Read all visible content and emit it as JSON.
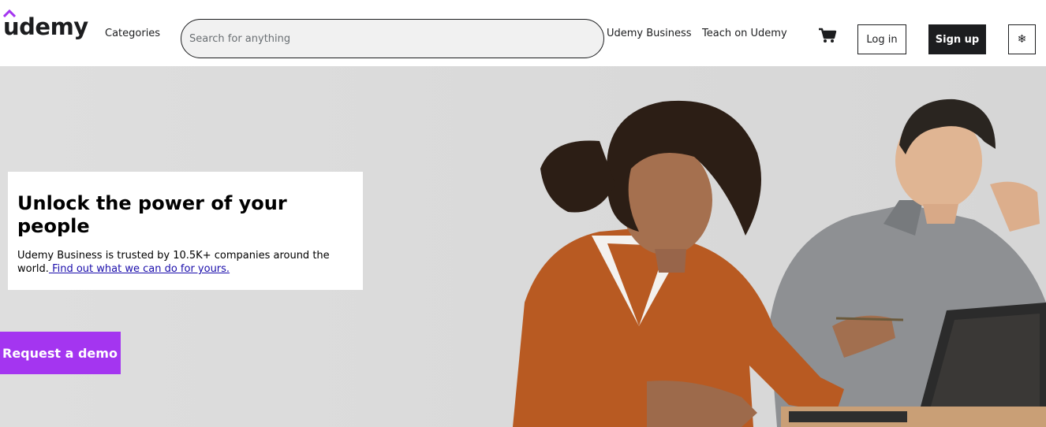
{
  "header": {
    "logo_text": "udemy",
    "categories_label": "Categories",
    "search": {
      "placeholder": "Search for anything",
      "value": ""
    },
    "udemy_business_label": "Udemy Business",
    "teach_label": "Teach on Udemy",
    "cart_icon": "shopping-cart-icon",
    "login_label": "Log in",
    "signup_label": "Sign up",
    "language_icon": "globe-icon",
    "language_glyph": "❄"
  },
  "hero": {
    "title": "Unlock the power of your people",
    "text": "Udemy Business is trusted by 10.5K+ companies around the world.",
    "link_text": " Find out what we can do for yours.",
    "demo_button": "Request a demo"
  },
  "colors": {
    "brand": "#a435f0",
    "text": "#1c1d1f",
    "link": "#1a0dab",
    "hero_bg": "#dcdcdc"
  }
}
